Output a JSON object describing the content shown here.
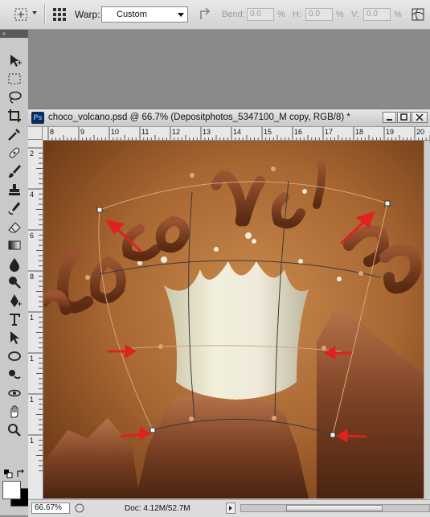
{
  "options_bar": {
    "warp_label": "Warp:",
    "warp_value": "Custom",
    "bend_label": "Bend:",
    "bend_value": "0.0",
    "bend_unit": "%",
    "h_label": "H:",
    "h_value": "0.0",
    "h_unit": "%",
    "v_label": "V:",
    "v_value": "0.0",
    "v_unit": "%"
  },
  "tools": {
    "header_glyph": "»",
    "icons": [
      "move-icon",
      "marquee-icon",
      "lasso-icon",
      "crop-icon",
      "eyedropper-icon",
      "healing-brush-icon",
      "brush-icon",
      "clone-stamp-icon",
      "history-brush-icon",
      "eraser-icon",
      "gradient-icon",
      "blur-icon",
      "dodge-icon",
      "pen-icon",
      "type-icon",
      "path-selection-icon",
      "shape-icon",
      "3d-rotate-icon",
      "3d-orbit-icon",
      "hand-icon",
      "zoom-icon"
    ]
  },
  "document": {
    "title": "choco_volcano.psd @ 66.7% (Depositphotos_5347100_M copy, RGB/8) *",
    "ps_badge": "Ps",
    "ruler_top": [
      "8",
      "9",
      "10",
      "11",
      "12",
      "13",
      "14",
      "15",
      "16",
      "17",
      "18",
      "19",
      "20"
    ],
    "ruler_left": [
      "2",
      "4",
      "6",
      "8",
      "1",
      "1",
      "1",
      "1"
    ],
    "canvas_text": "choco volcano",
    "zoom": "66.67%",
    "doc_info": "Doc: 4.12M/52.7M"
  }
}
